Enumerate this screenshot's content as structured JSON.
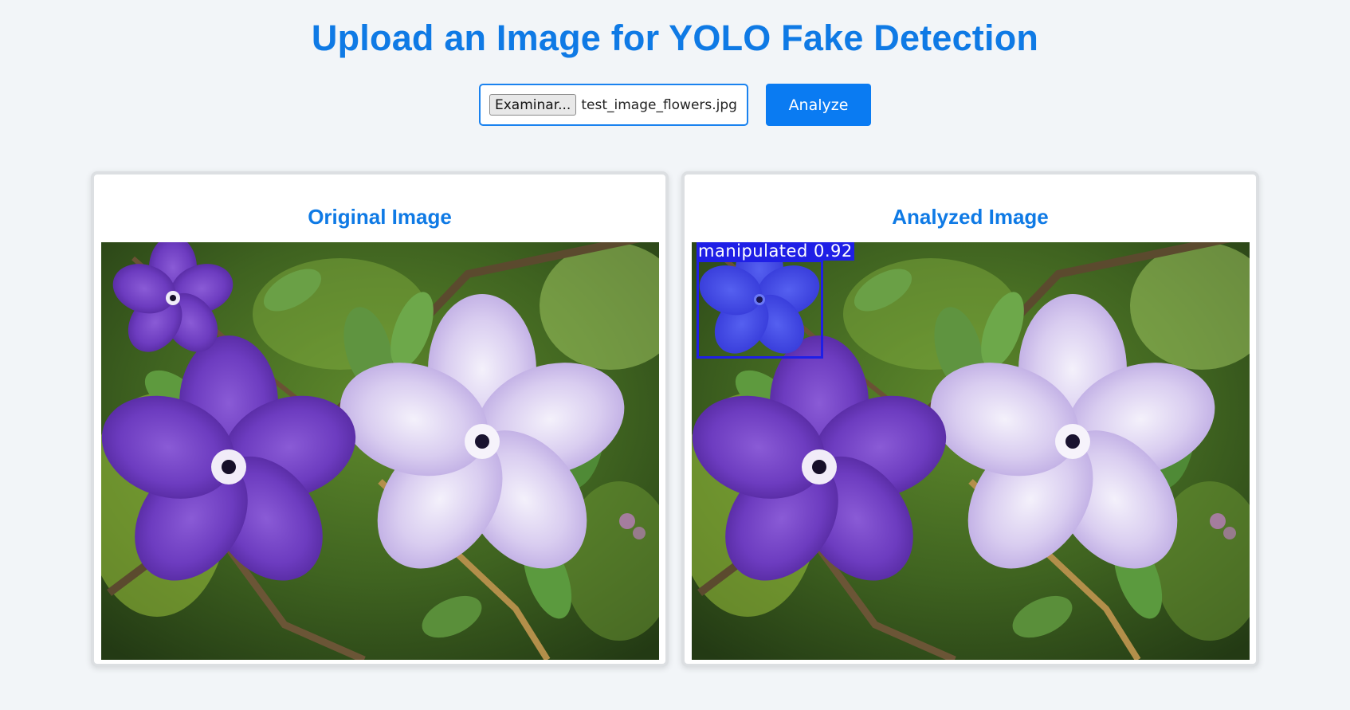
{
  "header": {
    "title": "Upload an Image for YOLO Fake Detection"
  },
  "upload": {
    "browse_label": "Examinar...",
    "file_name": "test_image_flowers.jpg",
    "analyze_label": "Analyze"
  },
  "panels": {
    "original": {
      "title": "Original Image"
    },
    "analyzed": {
      "title": "Analyzed Image",
      "detection_label": "manipulated 0.92"
    }
  },
  "colors": {
    "accent": "#0f7ae5",
    "button": "#0a7bf2",
    "detection_box": "#1f1fe6",
    "background": "#f2f5f8"
  }
}
